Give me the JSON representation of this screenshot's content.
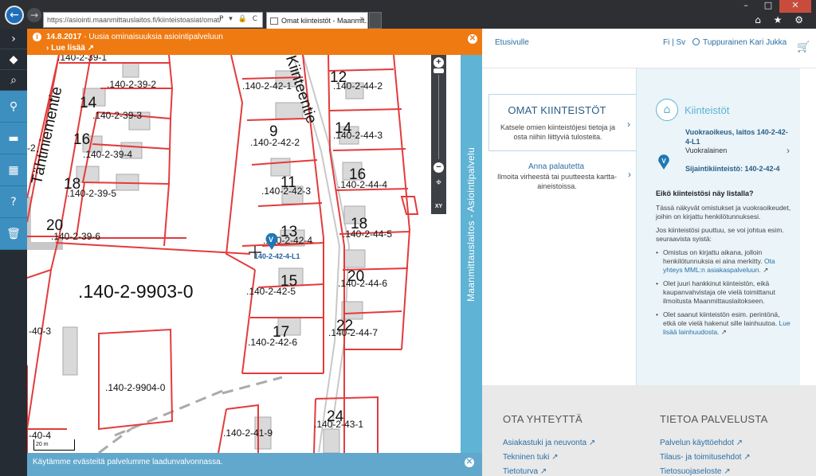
{
  "browser": {
    "url": "https://asiointi.maanmittauslaitos.fi/kiinteistoasiat/omat/",
    "tab_title": "Omat kiinteistöt - Maanmit...",
    "tab_close": "×",
    "back_icon": "←",
    "forward_icon": "→",
    "address_icons": "P ▾ 🔒 C",
    "window_min": "–",
    "window_max": "□",
    "window_close": "✕",
    "toolbar_icons": "⌂ ★ ⚙"
  },
  "sidebar": {
    "items": [
      {
        "icon": "chevron-right-icon",
        "glyph": "›"
      },
      {
        "icon": "layers-icon",
        "glyph": "◆"
      },
      {
        "icon": "search-icon",
        "glyph": "⌕"
      }
    ],
    "tools": [
      {
        "icon": "location-pin-icon",
        "glyph": "⚲"
      },
      {
        "icon": "measure-ruler-icon",
        "glyph": "▬"
      },
      {
        "icon": "measure-area-icon",
        "glyph": "▦"
      },
      {
        "icon": "help-tools-icon",
        "glyph": "?"
      },
      {
        "icon": "trash-icon",
        "glyph": "🗑"
      }
    ]
  },
  "banner": {
    "info_icon": "i",
    "date": "14.8.2017",
    "text": " - Uusia ominaisuuksia asiointipalveluun",
    "link": "Lue lisää",
    "close_icon": "✕"
  },
  "map": {
    "big_label": ".140-2-9903-0",
    "labels": [
      {
        "text": ".140-2-39-1"
      },
      {
        "text": ".140-2-39-2"
      },
      {
        "text": ".140-2-39-3"
      },
      {
        "text": ".140-2-39-4"
      },
      {
        "text": ".140-2-39-5"
      },
      {
        "text": ".140-2-39-6"
      },
      {
        "text": ".140-2-42-1"
      },
      {
        "text": ".140-2-42-2"
      },
      {
        "text": ".140-2-42-3"
      },
      {
        "text": ".140-2-42-4"
      },
      {
        "text": ".140-2-42-5"
      },
      {
        "text": ".140-2-42-6"
      },
      {
        "text": ".140-2-44-2"
      },
      {
        "text": ".140-2-44-3"
      },
      {
        "text": ".140-2-44-4"
      },
      {
        "text": ".140-2-44-5"
      },
      {
        "text": ".140-2-44-6"
      },
      {
        "text": ".140-2-44-7"
      },
      {
        "text": ".140-2-9904-0"
      },
      {
        "text": ".140-2-41-9"
      },
      {
        "text": ".140-2-43-1"
      },
      {
        "text": "-40-3"
      },
      {
        "text": "-40-4"
      },
      {
        "text": "-2"
      }
    ],
    "numbers": [
      "14",
      "16",
      "18",
      "20",
      "9",
      "11",
      "13",
      "15",
      "17",
      "12",
      "14",
      "16",
      "18",
      "20",
      "22",
      "24"
    ],
    "street_1": "Tähtiniementie",
    "street_2": "Kiinteentie",
    "marker_label": "140-2-42-4-L1",
    "marker_letter": "V",
    "scale": "20 m",
    "zoom_in": "+",
    "zoom_out": "−",
    "locate_icon": "⌖",
    "xy_label": "XY"
  },
  "cookie": {
    "text": "Käytämme evästeitä palvelumme laadunvalvonnassa.",
    "close_icon": "✕"
  },
  "side_tab": {
    "text": "Maanmittauslaitos - Asiointipalvelu"
  },
  "header": {
    "home": "Etusivulle",
    "lang": "Fi | Sv",
    "user": "Tuppurainen Kari Jukka",
    "cart_icon": "🛒"
  },
  "omat": {
    "title": "OMAT KIINTEISTÖT",
    "desc": "Katsele omien kiinteistöjesi tietoja ja osta niihin liittyviä tulosteita.",
    "chevron": "›"
  },
  "feedback": {
    "title": "Anna palautetta",
    "desc": "Ilmoita virheestä tai puutteesta kartta-aineistoissa.",
    "chevron": "›"
  },
  "kiinteistot": {
    "icon": "⌂",
    "title": "Kiinteistöt",
    "entry_title": "Vuokraoikeus, laitos 140-2-42-4-L1",
    "entry_sub": "Vuokralainen",
    "entry_chevron": "›",
    "pin_letter": "V",
    "parcel": "Sijaintikiinteistö: 140-2-42-4",
    "question": "Eikö kiinteistösi näy listalla?",
    "p1": "Tässä näkyvät omistukset ja vuokraoikeudet, joihin on kirjattu henkilötunnuksesi.",
    "p2": "Jos kiinteistösi puuttuu, se voi johtua esim. seuraavista syistä:",
    "b1": "Omistus on kirjattu aikana, jolloin henkilötunnuksia ei aina merkitty. ",
    "b1_link": "Ota yhteys MML:n asiakaspalveluun.",
    "b2": "Olet juuri hankkinut kiinteistön, eikä kaupanvahvistaja ole vielä toimittanut ilmoitusta Maanmittauslaitokseen.",
    "b3": "Olet saanut kiinteistön esim. perintönä, etkä ole vielä hakenut sille lainhuutoa. ",
    "b3_link": "Lue lisää lainhuudosta."
  },
  "footer": {
    "contact_title": "OTA YHTEYTTÄ",
    "contact_links": [
      "Asiakastuki ja neuvonta",
      "Tekninen tuki",
      "Tietoturva"
    ],
    "about_title": "TIETOA PALVELUSTA",
    "about_links": [
      "Palvelun käyttöehdot",
      "Tilaus- ja toimitusehdot",
      "Tietosuojaseloste"
    ]
  }
}
